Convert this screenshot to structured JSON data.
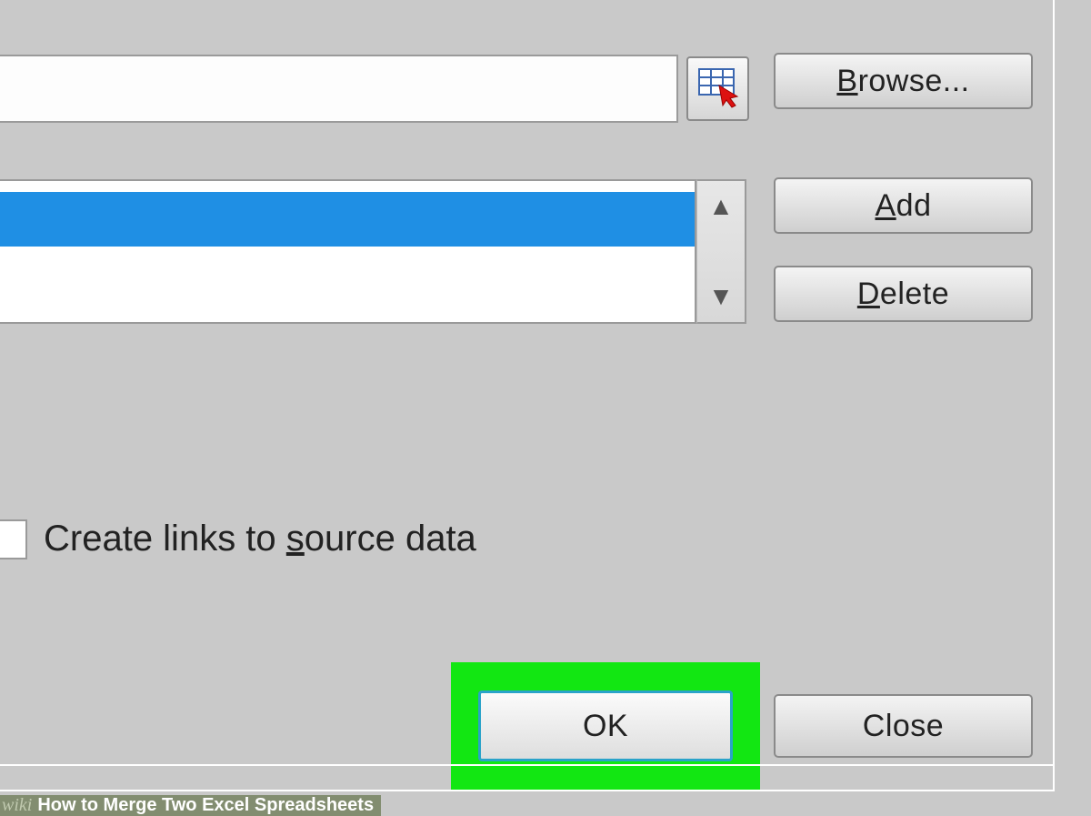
{
  "buttons": {
    "browse": "Browse...",
    "add": "Add",
    "delete": "Delete",
    "ok": "OK",
    "close": "Close"
  },
  "checkbox": {
    "create_links": "Create links to source data"
  },
  "watermark": {
    "prefix": "wiki",
    "text": "How to Merge Two Excel Spreadsheets"
  },
  "icons": {
    "range_selector": "table-pointer-icon",
    "scroll_up": "▲",
    "scroll_down": "▼"
  }
}
